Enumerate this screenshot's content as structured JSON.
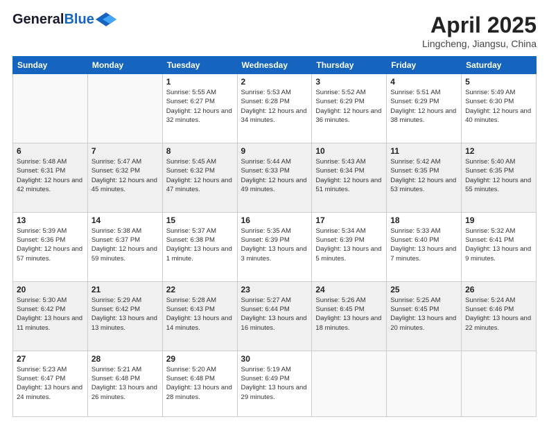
{
  "header": {
    "logo_line1": "General",
    "logo_line2": "Blue",
    "title": "April 2025",
    "location": "Lingcheng, Jiangsu, China"
  },
  "days_of_week": [
    "Sunday",
    "Monday",
    "Tuesday",
    "Wednesday",
    "Thursday",
    "Friday",
    "Saturday"
  ],
  "weeks": [
    [
      {
        "day": "",
        "info": ""
      },
      {
        "day": "",
        "info": ""
      },
      {
        "day": "1",
        "info": "Sunrise: 5:55 AM\nSunset: 6:27 PM\nDaylight: 12 hours and 32 minutes."
      },
      {
        "day": "2",
        "info": "Sunrise: 5:53 AM\nSunset: 6:28 PM\nDaylight: 12 hours and 34 minutes."
      },
      {
        "day": "3",
        "info": "Sunrise: 5:52 AM\nSunset: 6:29 PM\nDaylight: 12 hours and 36 minutes."
      },
      {
        "day": "4",
        "info": "Sunrise: 5:51 AM\nSunset: 6:29 PM\nDaylight: 12 hours and 38 minutes."
      },
      {
        "day": "5",
        "info": "Sunrise: 5:49 AM\nSunset: 6:30 PM\nDaylight: 12 hours and 40 minutes."
      }
    ],
    [
      {
        "day": "6",
        "info": "Sunrise: 5:48 AM\nSunset: 6:31 PM\nDaylight: 12 hours and 42 minutes."
      },
      {
        "day": "7",
        "info": "Sunrise: 5:47 AM\nSunset: 6:32 PM\nDaylight: 12 hours and 45 minutes."
      },
      {
        "day": "8",
        "info": "Sunrise: 5:45 AM\nSunset: 6:32 PM\nDaylight: 12 hours and 47 minutes."
      },
      {
        "day": "9",
        "info": "Sunrise: 5:44 AM\nSunset: 6:33 PM\nDaylight: 12 hours and 49 minutes."
      },
      {
        "day": "10",
        "info": "Sunrise: 5:43 AM\nSunset: 6:34 PM\nDaylight: 12 hours and 51 minutes."
      },
      {
        "day": "11",
        "info": "Sunrise: 5:42 AM\nSunset: 6:35 PM\nDaylight: 12 hours and 53 minutes."
      },
      {
        "day": "12",
        "info": "Sunrise: 5:40 AM\nSunset: 6:35 PM\nDaylight: 12 hours and 55 minutes."
      }
    ],
    [
      {
        "day": "13",
        "info": "Sunrise: 5:39 AM\nSunset: 6:36 PM\nDaylight: 12 hours and 57 minutes."
      },
      {
        "day": "14",
        "info": "Sunrise: 5:38 AM\nSunset: 6:37 PM\nDaylight: 12 hours and 59 minutes."
      },
      {
        "day": "15",
        "info": "Sunrise: 5:37 AM\nSunset: 6:38 PM\nDaylight: 13 hours and 1 minute."
      },
      {
        "day": "16",
        "info": "Sunrise: 5:35 AM\nSunset: 6:39 PM\nDaylight: 13 hours and 3 minutes."
      },
      {
        "day": "17",
        "info": "Sunrise: 5:34 AM\nSunset: 6:39 PM\nDaylight: 13 hours and 5 minutes."
      },
      {
        "day": "18",
        "info": "Sunrise: 5:33 AM\nSunset: 6:40 PM\nDaylight: 13 hours and 7 minutes."
      },
      {
        "day": "19",
        "info": "Sunrise: 5:32 AM\nSunset: 6:41 PM\nDaylight: 13 hours and 9 minutes."
      }
    ],
    [
      {
        "day": "20",
        "info": "Sunrise: 5:30 AM\nSunset: 6:42 PM\nDaylight: 13 hours and 11 minutes."
      },
      {
        "day": "21",
        "info": "Sunrise: 5:29 AM\nSunset: 6:42 PM\nDaylight: 13 hours and 13 minutes."
      },
      {
        "day": "22",
        "info": "Sunrise: 5:28 AM\nSunset: 6:43 PM\nDaylight: 13 hours and 14 minutes."
      },
      {
        "day": "23",
        "info": "Sunrise: 5:27 AM\nSunset: 6:44 PM\nDaylight: 13 hours and 16 minutes."
      },
      {
        "day": "24",
        "info": "Sunrise: 5:26 AM\nSunset: 6:45 PM\nDaylight: 13 hours and 18 minutes."
      },
      {
        "day": "25",
        "info": "Sunrise: 5:25 AM\nSunset: 6:45 PM\nDaylight: 13 hours and 20 minutes."
      },
      {
        "day": "26",
        "info": "Sunrise: 5:24 AM\nSunset: 6:46 PM\nDaylight: 13 hours and 22 minutes."
      }
    ],
    [
      {
        "day": "27",
        "info": "Sunrise: 5:23 AM\nSunset: 6:47 PM\nDaylight: 13 hours and 24 minutes."
      },
      {
        "day": "28",
        "info": "Sunrise: 5:21 AM\nSunset: 6:48 PM\nDaylight: 13 hours and 26 minutes."
      },
      {
        "day": "29",
        "info": "Sunrise: 5:20 AM\nSunset: 6:48 PM\nDaylight: 13 hours and 28 minutes."
      },
      {
        "day": "30",
        "info": "Sunrise: 5:19 AM\nSunset: 6:49 PM\nDaylight: 13 hours and 29 minutes."
      },
      {
        "day": "",
        "info": ""
      },
      {
        "day": "",
        "info": ""
      },
      {
        "day": "",
        "info": ""
      }
    ]
  ]
}
